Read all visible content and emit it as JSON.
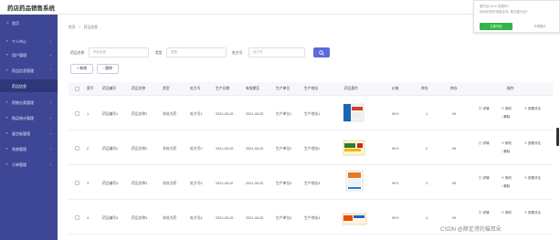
{
  "app_title": "药店药品销售系统",
  "sidebar": {
    "items": [
      {
        "label": "首页",
        "icon": "home-icon",
        "arrow": ""
      },
      {
        "label": "个人中心",
        "icon": "user-icon",
        "arrow": "⌄"
      },
      {
        "label": "用户管理",
        "icon": "users-icon",
        "arrow": "⌄"
      },
      {
        "label": "药品信息管理",
        "icon": "grid-icon",
        "arrow": "⌃"
      },
      {
        "label": "药品信息",
        "icon": "",
        "arrow": ""
      },
      {
        "label": "药物分类管理",
        "icon": "grid-icon",
        "arrow": "⌄"
      },
      {
        "label": "购买统计管理",
        "icon": "grid-icon",
        "arrow": "⌄"
      },
      {
        "label": "留言板管理",
        "icon": "grid-icon",
        "arrow": "⌄"
      },
      {
        "label": "系统管理",
        "icon": "gear-icon",
        "arrow": "⌄"
      },
      {
        "label": "订单管理",
        "icon": "grid-icon",
        "arrow": "⌄"
      }
    ]
  },
  "breadcrumb": {
    "home": "首页",
    "sep": "/",
    "current": "药品信息"
  },
  "filters": {
    "name_label": "药品名称",
    "name_placeholder": "药品名称",
    "type_label": "类型",
    "type_placeholder": "类型",
    "rx_label": "处方号",
    "rx_placeholder": "处方号"
  },
  "actions": {
    "add": "+ 新增",
    "delete": "删除"
  },
  "table": {
    "headers": [
      "索引",
      "药品编号",
      "药品名称",
      "类型",
      "处方号",
      "生产日期",
      "有效期至",
      "生产单位",
      "生产地址",
      "药品图片",
      "价格",
      "库存",
      "库存",
      "操作"
    ],
    "rows": [
      {
        "idx": "1",
        "code": "药品编号1",
        "name": "药品名称1",
        "type": "非处方药",
        "rx": "处方号1",
        "made": "2021-05-02",
        "expiry": "2021-05-02",
        "maker": "生产单位1",
        "addr": "生产地址1",
        "price": "99.9",
        "qty": "1",
        "stock": "99"
      },
      {
        "idx": "2",
        "code": "药品编号2",
        "name": "药品名称2",
        "type": "非处方药",
        "rx": "处方号2",
        "made": "2021-05-02",
        "expiry": "2021-05-02",
        "maker": "生产单位2",
        "addr": "生产地址2",
        "price": "99.9",
        "qty": "2",
        "stock": "99"
      },
      {
        "idx": "3",
        "code": "药品编号3",
        "name": "药品名称3",
        "type": "非处方药",
        "rx": "处方号3",
        "made": "2021-05-02",
        "expiry": "2021-05-02",
        "maker": "生产单位3",
        "addr": "生产地址3",
        "price": "99.9",
        "qty": "3",
        "stock": "99"
      },
      {
        "idx": "4",
        "code": "药品编号4",
        "name": "药品名称4",
        "type": "非处方药",
        "rx": "处方号4",
        "made": "2021-05-02",
        "expiry": "2021-05-02",
        "maker": "生产单位4",
        "addr": "生产地址4",
        "price": "99.9",
        "qty": "4",
        "stock": "99"
      }
    ],
    "ops": {
      "detail": "详情",
      "edit": "修改",
      "review": "查看评论",
      "delete": "删除"
    }
  },
  "popup": {
    "line1": "要开启 Aero 效果吗?",
    "line2": "检测到您的电脑支持, 是否要开启?",
    "confirm": "立即开启",
    "cancel": "不再提示"
  },
  "watermark": "CSDN @薛定谔的猫耳朵",
  "colors": {
    "sidebar": "#3d4795",
    "sidebar_active": "#2f3679",
    "accent": "#5b6bd8",
    "popup_btn": "#35b44a"
  }
}
